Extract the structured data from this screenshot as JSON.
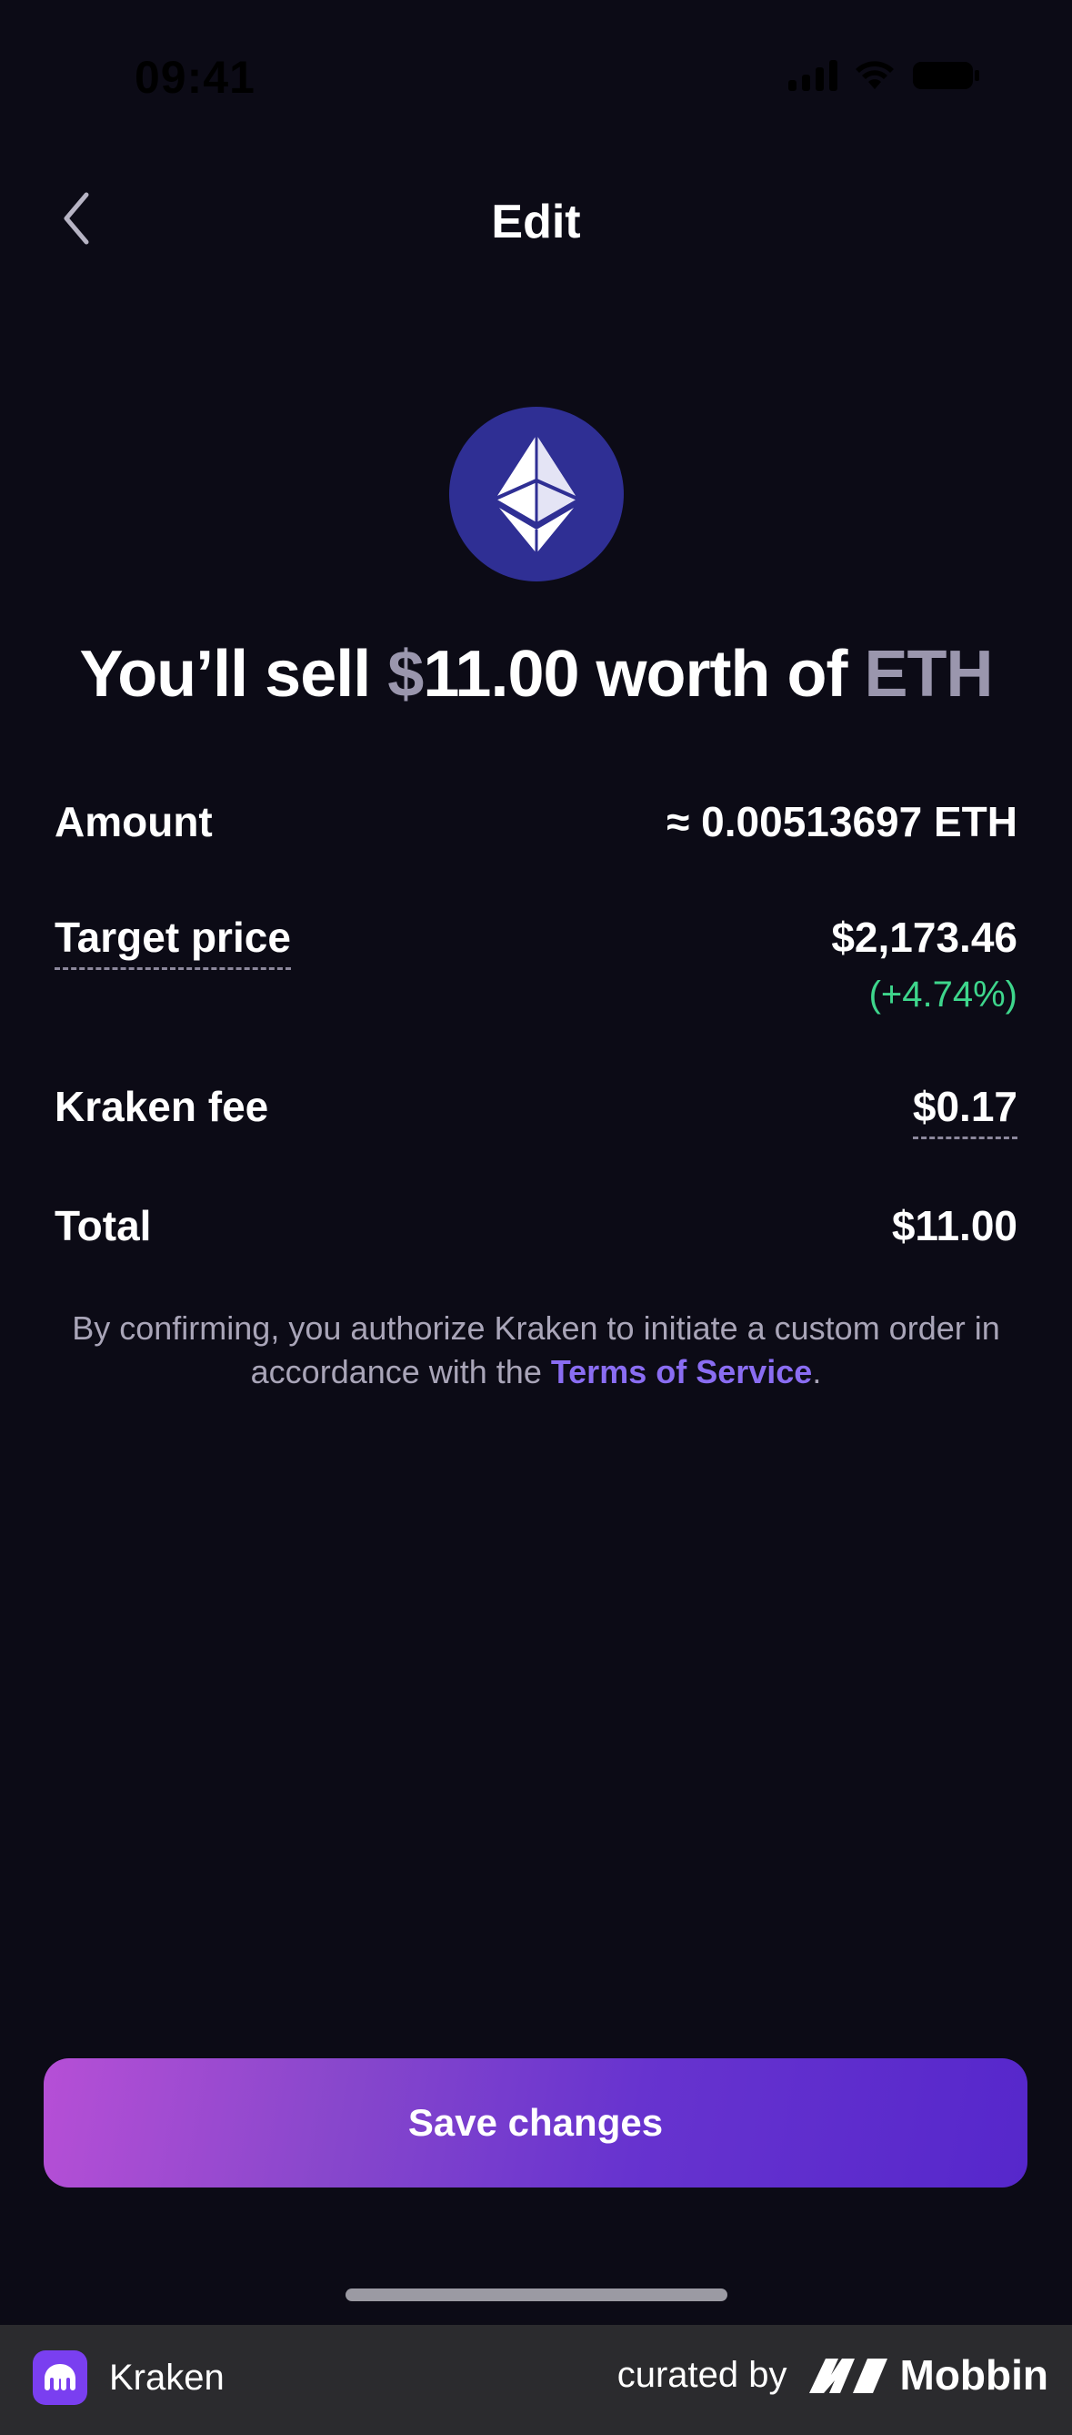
{
  "status_bar": {
    "time": "09:41"
  },
  "header": {
    "title": "Edit",
    "back_icon": "chevron-left-icon"
  },
  "asset": {
    "icon": "ethereum-icon",
    "logo_color": "#2f2f94"
  },
  "headline": {
    "prefix": "You’ll sell ",
    "currency_symbol": "$",
    "amount": "11.00",
    "middle": " worth of ",
    "asset": "ETH"
  },
  "details": {
    "amount": {
      "label": "Amount",
      "value": "≈ 0.00513697 ETH"
    },
    "target_price": {
      "label": "Target price",
      "value": "$2,173.46",
      "change": "(+4.74%)"
    },
    "fee": {
      "label": "Kraken fee",
      "value": "$0.17"
    },
    "total": {
      "label": "Total",
      "value": "$11.00"
    }
  },
  "disclaimer": {
    "text": "By confirming, you authorize Kraken to initiate a custom order in accordance with the ",
    "link": "Terms of Service",
    "suffix": "."
  },
  "actions": {
    "save_label": "Save changes"
  },
  "footer": {
    "app_name": "Kraken",
    "curated_by": "curated by",
    "brand": "Mobbin"
  },
  "colors": {
    "background": "#0c0b16",
    "positive": "#3ed68c",
    "link": "#8a6df2",
    "accent_start": "#b64fd6",
    "accent_end": "#5627cb"
  }
}
